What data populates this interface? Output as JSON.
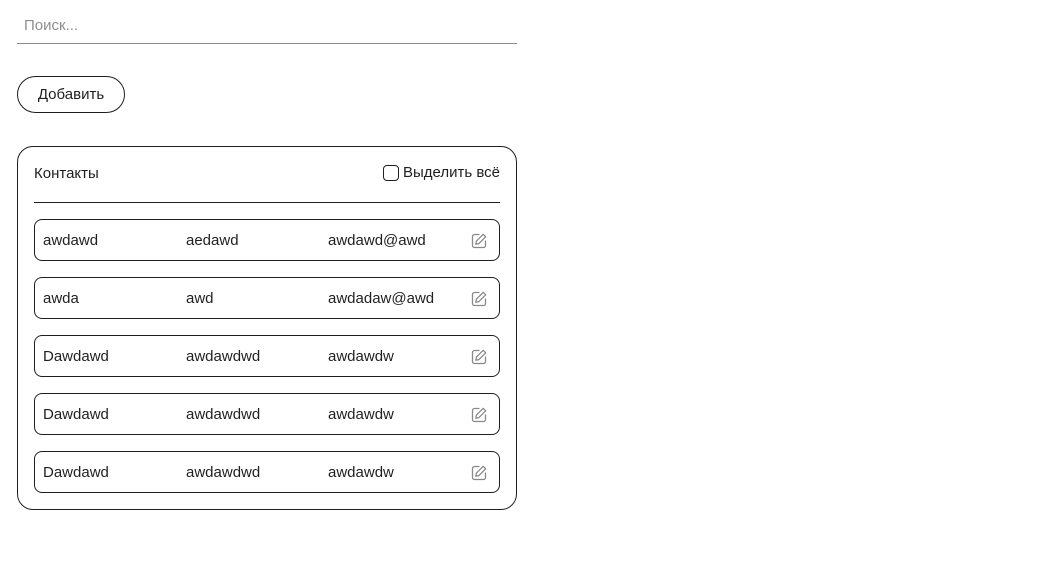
{
  "search": {
    "placeholder": "Поиск...",
    "value": ""
  },
  "toolbar": {
    "add_label": "Добавить"
  },
  "contacts": {
    "title": "Контакты",
    "select_all_label": "Выделить всё",
    "select_all_checked": false,
    "rows": [
      {
        "name": "awdawd",
        "surname": "aedawd",
        "email": "awdawd@awd",
        "action_icon": "edit-icon"
      },
      {
        "name": "awda",
        "surname": "awd",
        "email": "awdadaw@awd",
        "action_icon": "edit-icon"
      },
      {
        "name": "Dawdawd",
        "surname": "awdawdwd",
        "email": "awdawdw",
        "action_icon": "edit-icon"
      },
      {
        "name": "Dawdawd",
        "surname": "awdawdwd",
        "email": "awdawdw",
        "action_icon": "edit-icon"
      },
      {
        "name": "Dawdawd",
        "surname": "awdawdwd",
        "email": "awdawdw",
        "action_icon": "edit-icon"
      }
    ]
  },
  "colors": {
    "text": "#1f1f1f",
    "placeholder": "#8f8f8f",
    "border": "#1f1f1f",
    "icon": "#8a8a8a",
    "background": "#ffffff"
  }
}
